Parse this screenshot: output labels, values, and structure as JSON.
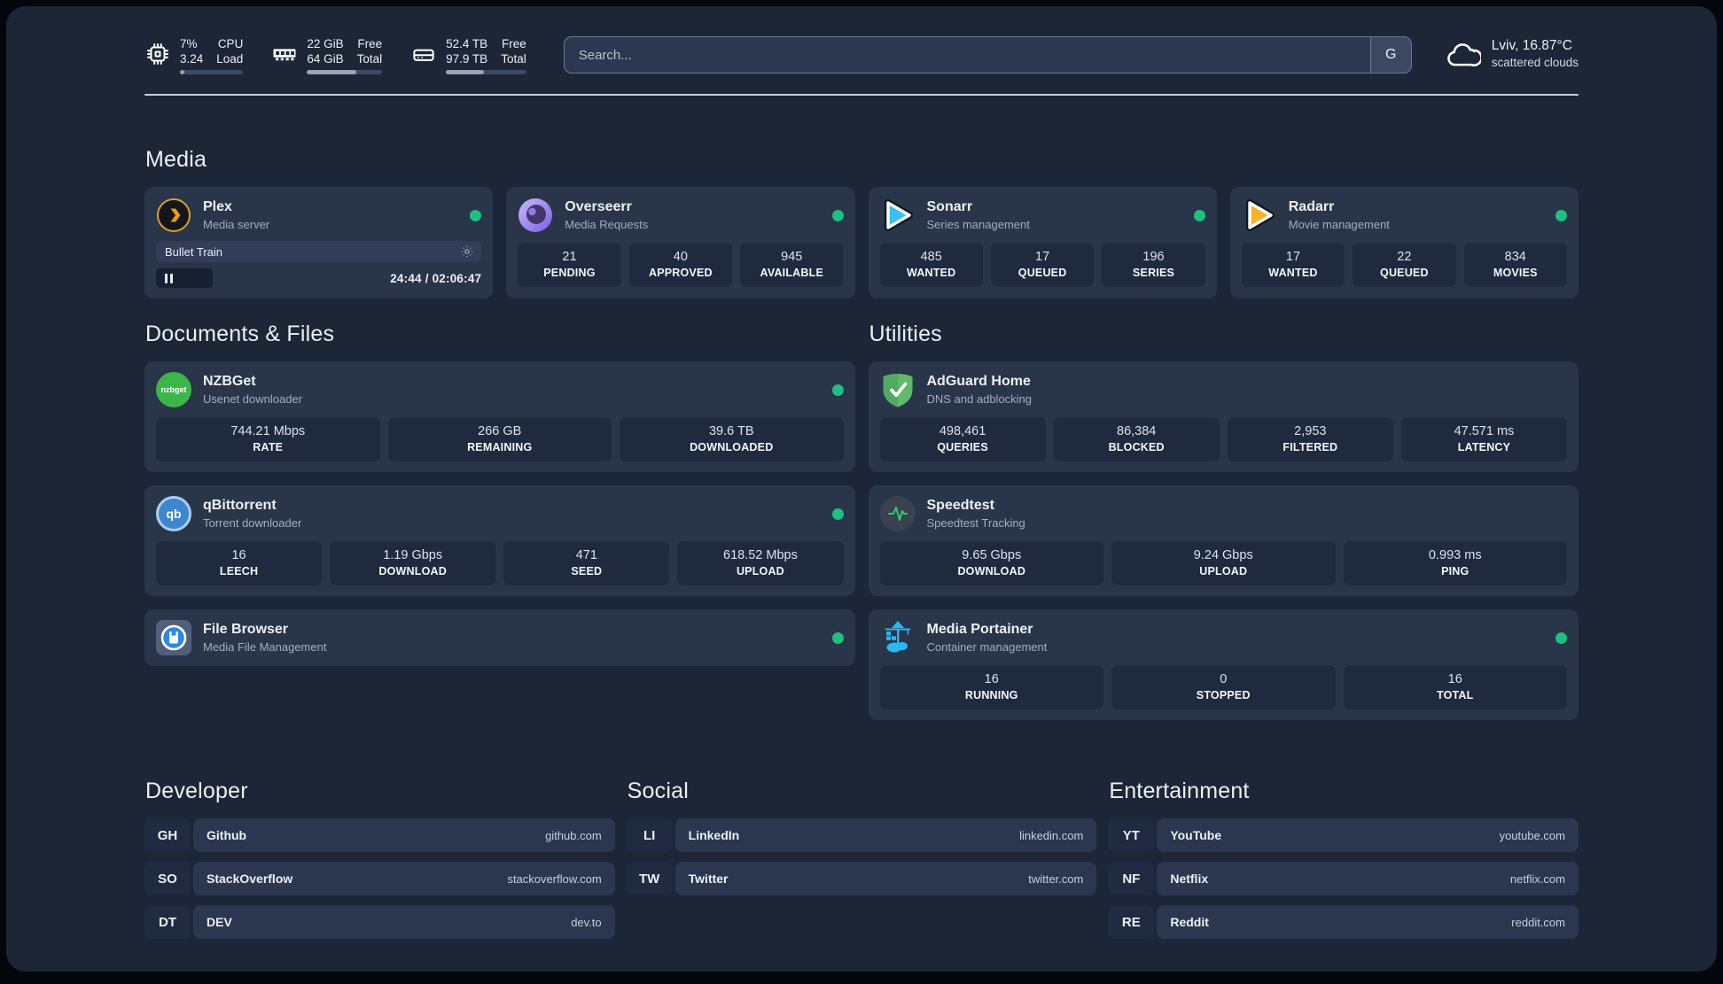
{
  "header": {
    "stats": [
      {
        "icon": "cpu-icon",
        "value_top": "7%",
        "value_bottom": "3.24",
        "label_top": "CPU",
        "label_bottom": "Load",
        "progress_pct": 7
      },
      {
        "icon": "memory-icon",
        "value_top": "22 GiB",
        "value_bottom": "64 GiB",
        "label_top": "Free",
        "label_bottom": "Total",
        "progress_pct": 66
      },
      {
        "icon": "disk-icon",
        "value_top": "52.4 TB",
        "value_bottom": "97.9 TB",
        "label_top": "Free",
        "label_bottom": "Total",
        "progress_pct": 47
      }
    ],
    "search": {
      "placeholder": "Search...",
      "engine_button_label": "G"
    },
    "weather": {
      "icon": "cloud-icon",
      "location_temperature": "Lviv, 16.87°C",
      "condition": "scattered clouds"
    }
  },
  "sections": {
    "media": {
      "title": "Media",
      "cards": [
        {
          "name": "Plex",
          "description": "Media server",
          "status": "online",
          "icon": "plex-icon",
          "player": {
            "title": "Bullet Train",
            "state": "paused",
            "time": "24:44 / 02:06:47"
          }
        },
        {
          "name": "Overseerr",
          "description": "Media Requests",
          "status": "online",
          "icon": "overseerr-icon",
          "stats": [
            {
              "value": "21",
              "label": "PENDING"
            },
            {
              "value": "40",
              "label": "APPROVED"
            },
            {
              "value": "945",
              "label": "AVAILABLE"
            }
          ]
        },
        {
          "name": "Sonarr",
          "description": "Series management",
          "status": "online",
          "icon": "sonarr-icon",
          "stats": [
            {
              "value": "485",
              "label": "WANTED"
            },
            {
              "value": "17",
              "label": "QUEUED"
            },
            {
              "value": "196",
              "label": "SERIES"
            }
          ]
        },
        {
          "name": "Radarr",
          "description": "Movie management",
          "status": "online",
          "icon": "radarr-icon",
          "stats": [
            {
              "value": "17",
              "label": "WANTED"
            },
            {
              "value": "22",
              "label": "QUEUED"
            },
            {
              "value": "834",
              "label": "MOVIES"
            }
          ]
        }
      ]
    },
    "documents": {
      "title": "Documents & Files",
      "cards": [
        {
          "name": "NZBGet",
          "description": "Usenet downloader",
          "status": "online",
          "icon": "nzbget-icon",
          "icon_text": "nzbget",
          "stats": [
            {
              "value": "744.21 Mbps",
              "label": "RATE"
            },
            {
              "value": "266 GB",
              "label": "REMAINING"
            },
            {
              "value": "39.6 TB",
              "label": "DOWNLOADED"
            }
          ]
        },
        {
          "name": "qBittorrent",
          "description": "Torrent downloader",
          "status": "online",
          "icon": "qbittorrent-icon",
          "icon_text": "qb",
          "stats": [
            {
              "value": "16",
              "label": "LEECH"
            },
            {
              "value": "1.19 Gbps",
              "label": "DOWNLOAD"
            },
            {
              "value": "471",
              "label": "SEED"
            },
            {
              "value": "618.52 Mbps",
              "label": "UPLOAD"
            }
          ]
        },
        {
          "name": "File Browser",
          "description": "Media File Management",
          "status": "online",
          "icon": "filebrowser-icon"
        }
      ]
    },
    "utilities": {
      "title": "Utilities",
      "cards": [
        {
          "name": "AdGuard Home",
          "description": "DNS and adblocking",
          "icon": "adguard-icon",
          "stats": [
            {
              "value": "498,461",
              "label": "QUERIES"
            },
            {
              "value": "86,384",
              "label": "BLOCKED"
            },
            {
              "value": "2,953",
              "label": "FILTERED"
            },
            {
              "value": "47.571 ms",
              "label": "LATENCY"
            }
          ]
        },
        {
          "name": "Speedtest",
          "description": "Speedtest Tracking",
          "icon": "speedtest-icon",
          "stats": [
            {
              "value": "9.65 Gbps",
              "label": "DOWNLOAD"
            },
            {
              "value": "9.24 Gbps",
              "label": "UPLOAD"
            },
            {
              "value": "0.993 ms",
              "label": "PING"
            }
          ]
        },
        {
          "name": "Media Portainer",
          "description": "Container management",
          "status": "online",
          "icon": "portainer-icon",
          "stats": [
            {
              "value": "16",
              "label": "RUNNING"
            },
            {
              "value": "0",
              "label": "STOPPED"
            },
            {
              "value": "16",
              "label": "TOTAL"
            }
          ]
        }
      ]
    },
    "developer": {
      "title": "Developer",
      "links": [
        {
          "abbr": "GH",
          "name": "Github",
          "url": "github.com"
        },
        {
          "abbr": "SO",
          "name": "StackOverflow",
          "url": "stackoverflow.com"
        },
        {
          "abbr": "DT",
          "name": "DEV",
          "url": "dev.to"
        }
      ]
    },
    "social": {
      "title": "Social",
      "links": [
        {
          "abbr": "LI",
          "name": "LinkedIn",
          "url": "linkedin.com"
        },
        {
          "abbr": "TW",
          "name": "Twitter",
          "url": "twitter.com"
        }
      ]
    },
    "entertainment": {
      "title": "Entertainment",
      "links": [
        {
          "abbr": "YT",
          "name": "YouTube",
          "url": "youtube.com"
        },
        {
          "abbr": "NF",
          "name": "Netflix",
          "url": "netflix.com"
        },
        {
          "abbr": "RE",
          "name": "Reddit",
          "url": "reddit.com"
        }
      ]
    }
  },
  "colors": {
    "status_online": "#1fbf7f",
    "plex": "#e5a00d",
    "sonarr": "#38c1f2",
    "radarr": "#fdb22a",
    "nzbget": "#3cb549",
    "qbittorrent": "#3e87cf",
    "adguard": "#5fba6e",
    "speedtest_pulse": "#2ecc71",
    "filebrowser": "#2e86e8",
    "portainer": "#29b8f5"
  }
}
